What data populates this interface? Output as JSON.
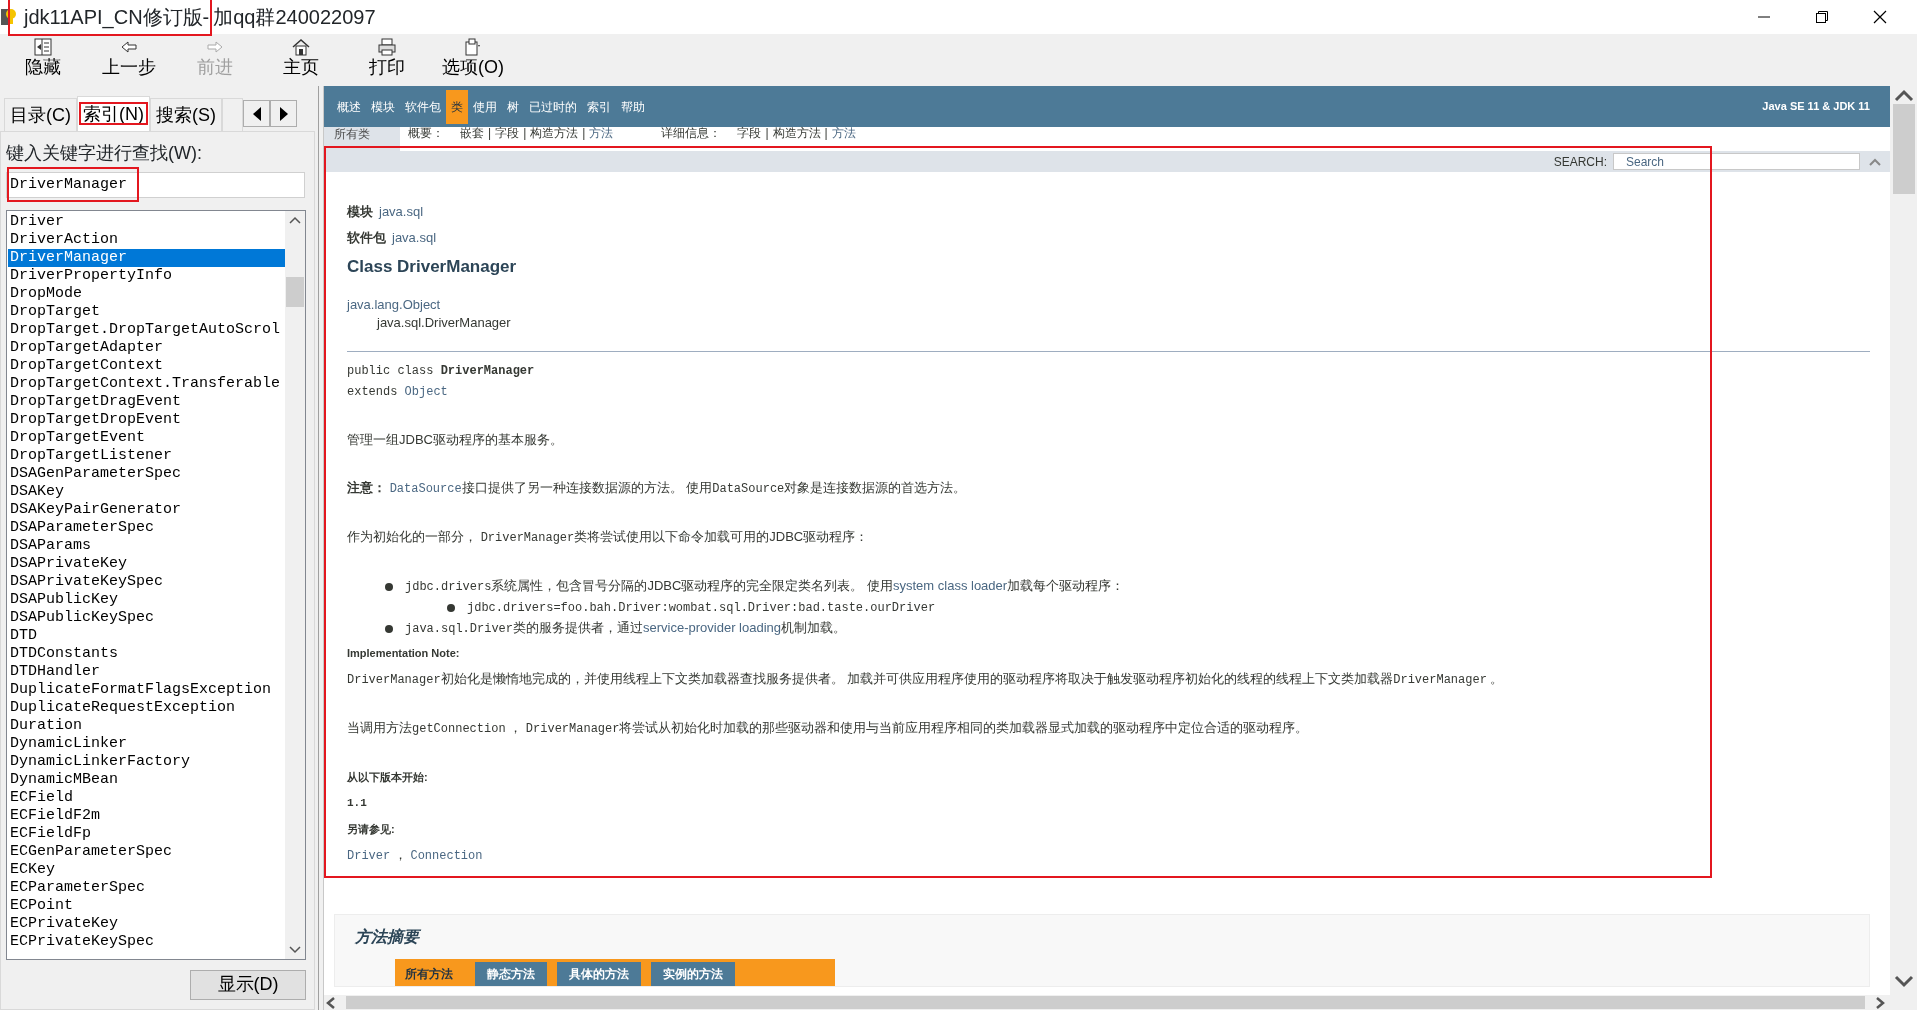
{
  "window": {
    "title": [
      {
        "text": "jdk11API_CN修订版-",
        "highlighted": true
      },
      {
        "text": "加qq群240022097",
        "highlighted": false
      }
    ]
  },
  "toolbar": [
    {
      "kind": "hide",
      "label": "隐藏",
      "disabled": false
    },
    {
      "kind": "back",
      "label": "上一步",
      "disabled": false
    },
    {
      "kind": "forward",
      "label": "前进",
      "disabled": true
    },
    {
      "kind": "home",
      "label": "主页",
      "disabled": false
    },
    {
      "kind": "print",
      "label": "打印",
      "disabled": false
    },
    {
      "kind": "options",
      "label": "选项(O)",
      "disabled": false
    }
  ],
  "sidebar": {
    "tabs": [
      {
        "label": "目录(C)",
        "selected": false,
        "highlighted": false
      },
      {
        "label": "索引(N)",
        "selected": true,
        "highlighted": true
      },
      {
        "label": "搜索(S)",
        "selected": false,
        "highlighted": false
      }
    ],
    "keyword_label": "键入关键字进行查找(W):",
    "keyword_field": {
      "value": "DriverManager",
      "highlighted": true
    },
    "items": [
      {
        "label": "Driver",
        "selected": false
      },
      {
        "label": "DriverAction",
        "selected": false
      },
      {
        "label": "DriverManager",
        "selected": true
      },
      {
        "label": "DriverPropertyInfo",
        "selected": false
      },
      {
        "label": "DropMode",
        "selected": false
      },
      {
        "label": "DropTarget",
        "selected": false
      },
      {
        "label": "DropTarget.DropTargetAutoScrol",
        "selected": false
      },
      {
        "label": "DropTargetAdapter",
        "selected": false
      },
      {
        "label": "DropTargetContext",
        "selected": false
      },
      {
        "label": "DropTargetContext.Transferable",
        "selected": false
      },
      {
        "label": "DropTargetDragEvent",
        "selected": false
      },
      {
        "label": "DropTargetDropEvent",
        "selected": false
      },
      {
        "label": "DropTargetEvent",
        "selected": false
      },
      {
        "label": "DropTargetListener",
        "selected": false
      },
      {
        "label": "DSAGenParameterSpec",
        "selected": false
      },
      {
        "label": "DSAKey",
        "selected": false
      },
      {
        "label": "DSAKeyPairGenerator",
        "selected": false
      },
      {
        "label": "DSAParameterSpec",
        "selected": false
      },
      {
        "label": "DSAParams",
        "selected": false
      },
      {
        "label": "DSAPrivateKey",
        "selected": false
      },
      {
        "label": "DSAPrivateKeySpec",
        "selected": false
      },
      {
        "label": "DSAPublicKey",
        "selected": false
      },
      {
        "label": "DSAPublicKeySpec",
        "selected": false
      },
      {
        "label": "DTD",
        "selected": false
      },
      {
        "label": "DTDConstants",
        "selected": false
      },
      {
        "label": "DTDHandler",
        "selected": false
      },
      {
        "label": "DuplicateFormatFlagsException",
        "selected": false
      },
      {
        "label": "DuplicateRequestException",
        "selected": false
      },
      {
        "label": "Duration",
        "selected": false
      },
      {
        "label": "DynamicLinker",
        "selected": false
      },
      {
        "label": "DynamicLinkerFactory",
        "selected": false
      },
      {
        "label": "DynamicMBean",
        "selected": false
      },
      {
        "label": "ECField",
        "selected": false
      },
      {
        "label": "ECFieldF2m",
        "selected": false
      },
      {
        "label": "ECFieldFp",
        "selected": false
      },
      {
        "label": "ECGenParameterSpec",
        "selected": false
      },
      {
        "label": "ECKey",
        "selected": false
      },
      {
        "label": "ECParameterSpec",
        "selected": false
      },
      {
        "label": "ECPoint",
        "selected": false
      },
      {
        "label": "ECPrivateKey",
        "selected": false
      },
      {
        "label": "ECPrivateKeySpec",
        "selected": false
      }
    ],
    "display_button": "显示(D)"
  },
  "document": {
    "nav": [
      {
        "label": "概述",
        "selected": false
      },
      {
        "label": "模块",
        "selected": false
      },
      {
        "label": "软件包",
        "selected": false
      },
      {
        "label": "类",
        "selected": true
      },
      {
        "label": "使用",
        "selected": false
      },
      {
        "label": "树",
        "selected": false
      },
      {
        "label": "已过时的",
        "selected": false
      },
      {
        "label": "索引",
        "selected": false
      },
      {
        "label": "帮助",
        "selected": false
      }
    ],
    "version": "Java SE 11 & JDK 11",
    "all_classes": "所有类",
    "subnav": [
      {
        "text": "概要：",
        "kind": "label"
      },
      {
        "text": "嵌套",
        "kind": "plain"
      },
      {
        "text": "|",
        "kind": "separator"
      },
      {
        "text": "字段",
        "kind": "plain"
      },
      {
        "text": "|",
        "kind": "separator"
      },
      {
        "text": "构造方法",
        "kind": "plain"
      },
      {
        "text": "|",
        "kind": "separator"
      },
      {
        "text": "方法",
        "kind": "link"
      },
      {
        "text": "详细信息：",
        "kind": "label"
      },
      {
        "text": "字段",
        "kind": "plain"
      },
      {
        "text": "|",
        "kind": "separator"
      },
      {
        "text": "构造方法",
        "kind": "plain"
      },
      {
        "text": "|",
        "kind": "separator"
      },
      {
        "text": "方法",
        "kind": "link"
      }
    ],
    "search": {
      "label": "SEARCH:",
      "placeholder": "Search"
    },
    "highlighted": true,
    "blocks": [
      {
        "kind": "field",
        "label": "模块",
        "value": "java.sql"
      },
      {
        "kind": "field",
        "label": "软件包",
        "value": "java.sql"
      },
      {
        "kind": "heading",
        "text": "Class DriverManager"
      },
      {
        "kind": "inheritance",
        "parent": "java.lang.Object",
        "child": "java.sql.DriverManager"
      },
      {
        "kind": "rule"
      },
      {
        "kind": "signature",
        "lines": [
          [
            {
              "text": "public class ",
              "kind": "code"
            },
            {
              "text": "DriverManager",
              "kind": "codebold"
            }
          ],
          [
            {
              "text": "extends ",
              "kind": "code"
            },
            {
              "text": "Object",
              "kind": "codelink"
            }
          ]
        ]
      },
      {
        "kind": "paragraph",
        "segments": [
          {
            "text": "管理一组JDBC驱动程序的基本服务。",
            "kind": "plain"
          }
        ]
      },
      {
        "kind": "paragraph",
        "segments": [
          {
            "text": "注意： ",
            "kind": "bold"
          },
          {
            "text": "DataSource",
            "kind": "codelink"
          },
          {
            "text": "接口提供了另一种连接数据源的方法。 使用",
            "kind": "plain"
          },
          {
            "text": "DataSource",
            "kind": "code"
          },
          {
            "text": "对象是连接数据源的首选方法。",
            "kind": "plain"
          }
        ]
      },
      {
        "kind": "paragraph",
        "segments": [
          {
            "text": "作为初始化的一部分， ",
            "kind": "plain"
          },
          {
            "text": "DriverManager",
            "kind": "code"
          },
          {
            "text": "类将尝试使用以下命令加载可用的JDBC驱动程序：",
            "kind": "plain"
          }
        ]
      },
      {
        "kind": "list",
        "items": [
          {
            "segments": [
              {
                "text": "jdbc.drivers",
                "kind": "code"
              },
              {
                "text": "系统属性，包含冒号分隔的JDBC驱动程序的完全限定类名列表。 使用",
                "kind": "plain"
              },
              {
                "text": "system class loader",
                "kind": "link"
              },
              {
                "text": "加载每个驱动程序：",
                "kind": "plain"
              }
            ],
            "children": [
              {
                "segments": [
                  {
                    "text": "jdbc.drivers=foo.bah.Driver:wombat.sql.Driver:bad.taste.ourDriver",
                    "kind": "code"
                  }
                ]
              }
            ]
          },
          {
            "segments": [
              {
                "text": "java.sql.Driver",
                "kind": "code"
              },
              {
                "text": "类的服务提供者，通过",
                "kind": "plain"
              },
              {
                "text": "service-provider loading",
                "kind": "link"
              },
              {
                "text": "机制加载。",
                "kind": "plain"
              }
            ]
          }
        ]
      },
      {
        "kind": "label",
        "text": "Implementation Note:"
      },
      {
        "kind": "paragraph",
        "segments": [
          {
            "text": "DriverManager",
            "kind": "code"
          },
          {
            "text": "初始化是懒惰地完成的，并使用线程上下文类加载器查找服务提供者。 加载并可供应用程序使用的驱动程序将取决于触发驱动程序初始化的线程的线程上下文类加载器",
            "kind": "plain"
          },
          {
            "text": "DriverManager",
            "kind": "code"
          },
          {
            "text": " 。",
            "kind": "plain"
          }
        ]
      },
      {
        "kind": "paragraph",
        "segments": [
          {
            "text": "当调用方法",
            "kind": "plain"
          },
          {
            "text": "getConnection",
            "kind": "code"
          },
          {
            "text": " ， ",
            "kind": "plain"
          },
          {
            "text": "DriverManager",
            "kind": "code"
          },
          {
            "text": "将尝试从初始化时加载的那些驱动器和使用与当前应用程序相同的类加载器显式加载的驱动程序中定位合适的驱动程序。",
            "kind": "plain"
          }
        ]
      },
      {
        "kind": "label",
        "text": "从以下版本开始:"
      },
      {
        "kind": "value",
        "text": "1.1"
      },
      {
        "kind": "label",
        "text": "另请参见:"
      },
      {
        "kind": "paragraph",
        "segments": [
          {
            "text": "Driver",
            "kind": "codelink"
          },
          {
            "text": " ， ",
            "kind": "plain"
          },
          {
            "text": "Connection",
            "kind": "codelink"
          }
        ]
      }
    ],
    "method_summary": {
      "title": "方法摘要",
      "tabs": [
        {
          "label": "所有方法",
          "selected": true
        },
        {
          "label": "静态方法",
          "selected": false
        },
        {
          "label": "具体的方法",
          "selected": false
        },
        {
          "label": "实例的方法",
          "selected": false
        }
      ]
    }
  }
}
